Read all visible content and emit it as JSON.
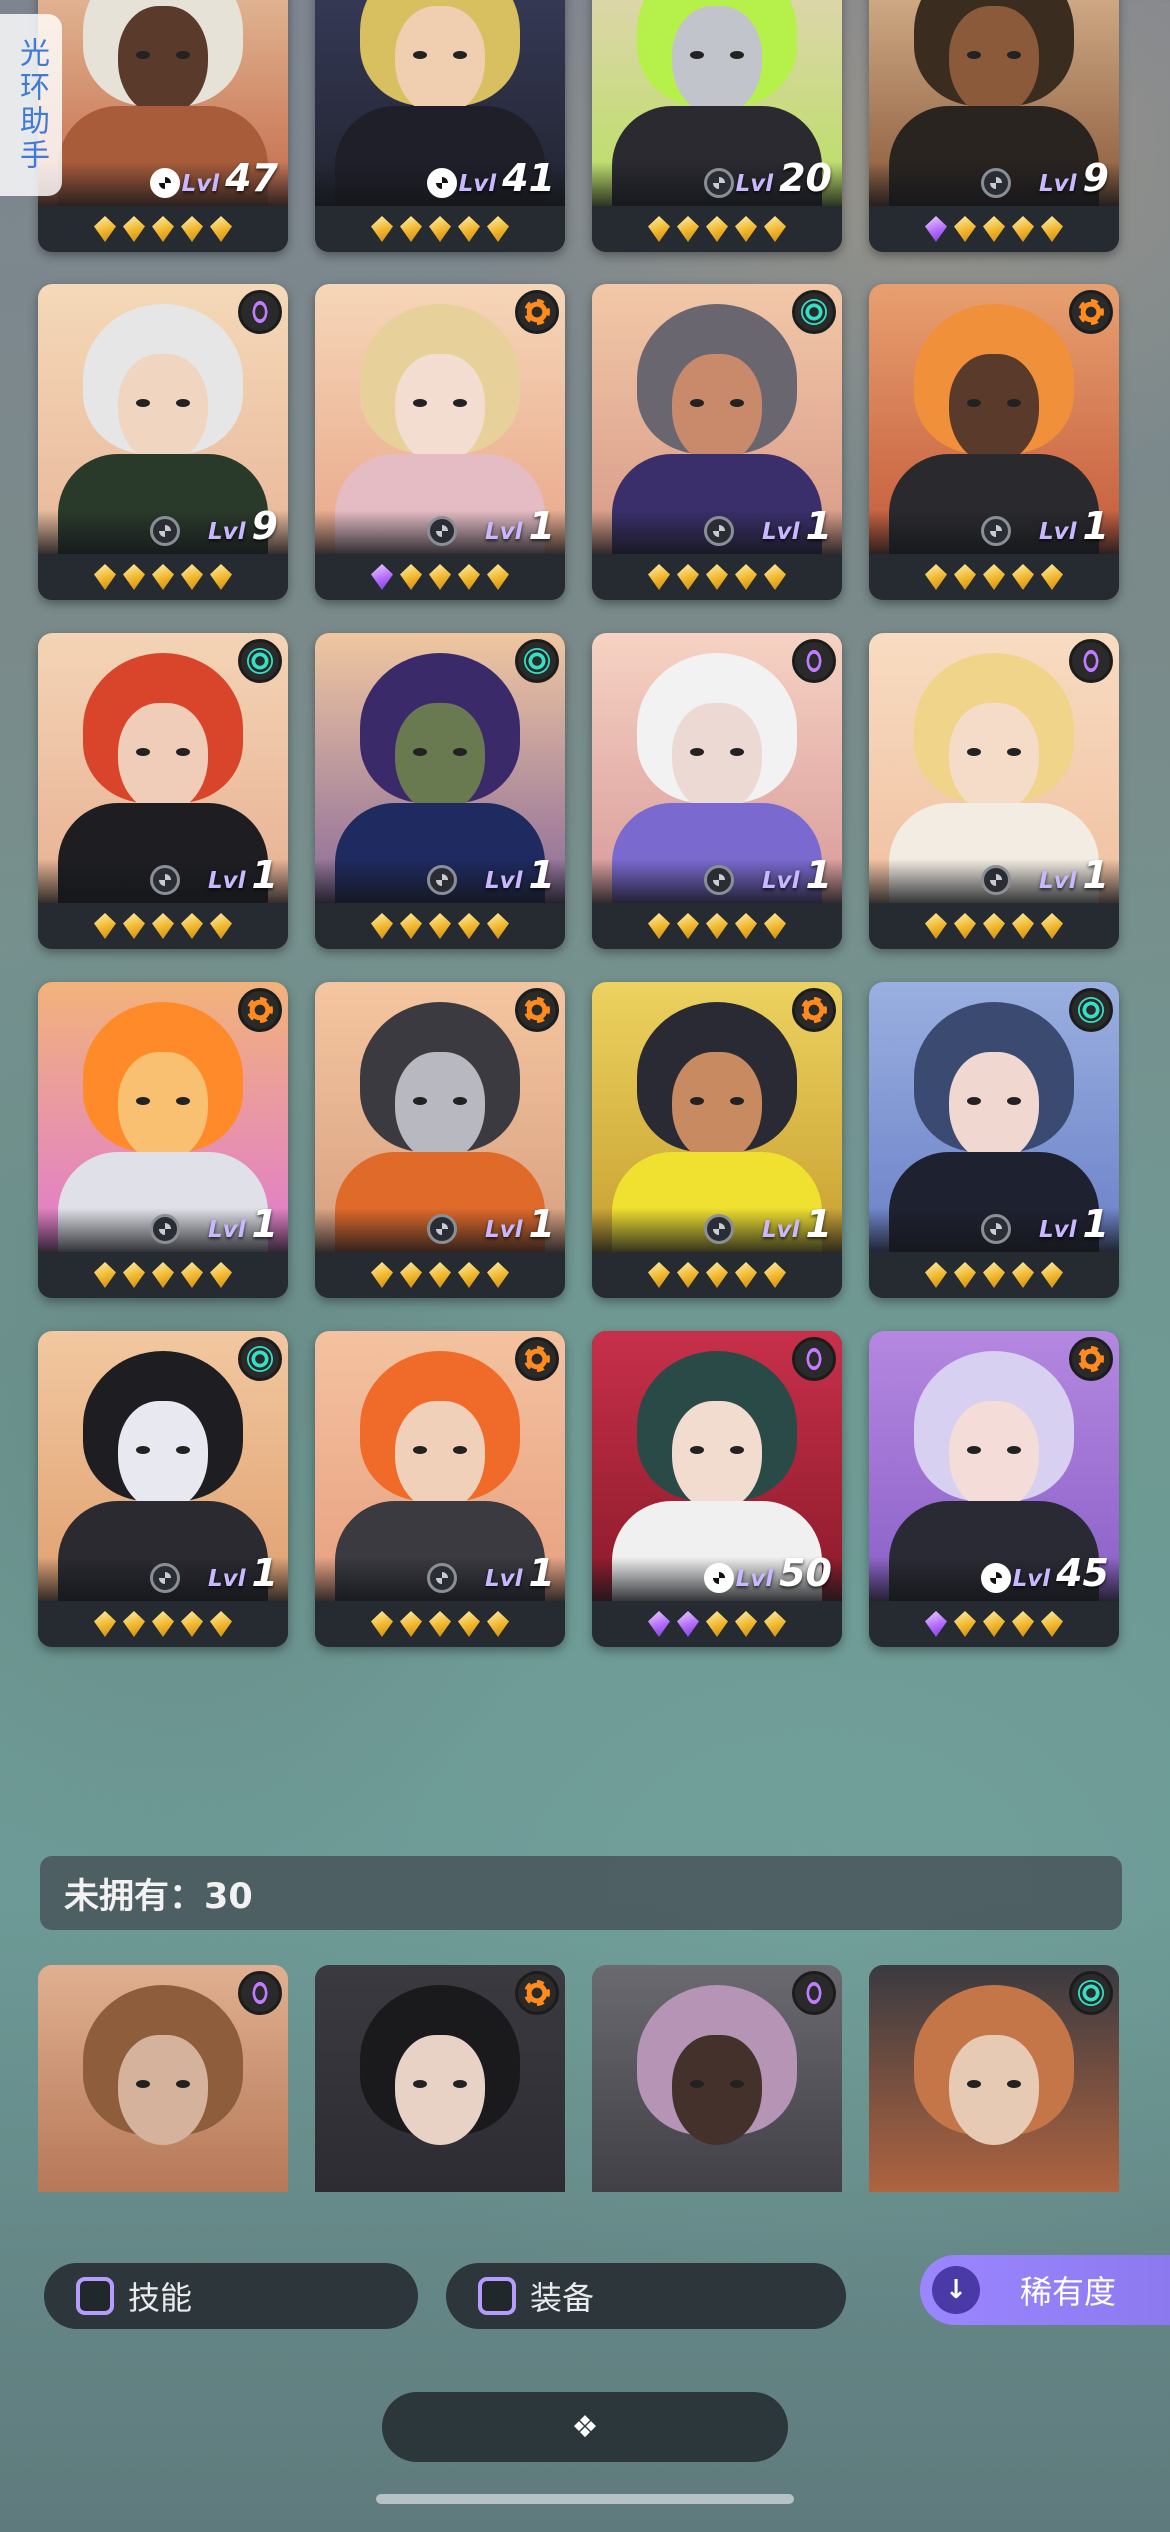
{
  "assistant": {
    "label": "光环助手"
  },
  "owned_cards": [
    {
      "level": "47",
      "stars": [
        "gold",
        "gold",
        "gold",
        "gold",
        "gold"
      ],
      "element": "",
      "bg": [
        "#e9c9a6",
        "#c46a4a"
      ],
      "hair": "#e6e2d8",
      "skin": "#5a3a2a",
      "outfit": "#a85c3a",
      "wheel": "white"
    },
    {
      "level": "41",
      "stars": [
        "gold",
        "gold",
        "gold",
        "gold",
        "gold"
      ],
      "element": "",
      "bg": [
        "#3a3f60",
        "#222430"
      ],
      "hair": "#d8c060",
      "skin": "#f0cfb0",
      "outfit": "#1f1f2a",
      "wheel": "white"
    },
    {
      "level": "20",
      "stars": [
        "gold",
        "gold",
        "gold",
        "gold",
        "gold"
      ],
      "element": "",
      "bg": [
        "#e8d2c0",
        "#b8e060"
      ],
      "hair": "#b6f04a",
      "skin": "#c2c4cc",
      "outfit": "#2a2a30",
      "wheel": "dark"
    },
    {
      "level": "9",
      "stars": [
        "purple",
        "gold",
        "gold",
        "gold",
        "gold"
      ],
      "element": "",
      "bg": [
        "#e2c09a",
        "#8a5a3a"
      ],
      "hair": "#3b2c20",
      "skin": "#8a5a3a",
      "outfit": "#2a2420",
      "wheel": "dark"
    },
    {
      "level": "9",
      "stars": [
        "gold",
        "gold",
        "gold",
        "gold",
        "gold"
      ],
      "element": "purple",
      "bg": [
        "#f4d9b8",
        "#e9b79a"
      ],
      "hair": "#e6e6e6",
      "skin": "#f0d5c0",
      "outfit": "#2a3a2a",
      "wheel": "dark"
    },
    {
      "level": "1",
      "stars": [
        "purple",
        "gold",
        "gold",
        "gold",
        "gold"
      ],
      "element": "orange",
      "bg": [
        "#f6d6b8",
        "#e9a78a"
      ],
      "hair": "#e8d09a",
      "skin": "#f3dcd0",
      "outfit": "#e5bcc4",
      "wheel": "dark"
    },
    {
      "level": "1",
      "stars": [
        "gold",
        "gold",
        "gold",
        "gold",
        "gold"
      ],
      "element": "green",
      "bg": [
        "#f2c8a8",
        "#d89a88"
      ],
      "hair": "#6a6670",
      "skin": "#c88a6a",
      "outfit": "#3a2f6a",
      "wheel": "dark"
    },
    {
      "level": "1",
      "stars": [
        "gold",
        "gold",
        "gold",
        "gold",
        "gold"
      ],
      "element": "orange",
      "bg": [
        "#e8a070",
        "#c45a3a"
      ],
      "hair": "#f0903a",
      "skin": "#5a3a2a",
      "outfit": "#2a2a2e",
      "wheel": "dark"
    },
    {
      "level": "1",
      "stars": [
        "gold",
        "gold",
        "gold",
        "gold",
        "gold"
      ],
      "element": "green",
      "bg": [
        "#f4d4b6",
        "#e8b092"
      ],
      "hair": "#d8452a",
      "skin": "#f0cdb8",
      "outfit": "#1e1e22",
      "wheel": "dark"
    },
    {
      "level": "1",
      "stars": [
        "gold",
        "gold",
        "gold",
        "gold",
        "gold"
      ],
      "element": "green",
      "bg": [
        "#f0c7a0",
        "#8a6a9a"
      ],
      "hair": "#3a2a6a",
      "skin": "#6a7a50",
      "outfit": "#1e2a60",
      "wheel": "dark"
    },
    {
      "level": "1",
      "stars": [
        "gold",
        "gold",
        "gold",
        "gold",
        "gold"
      ],
      "element": "purple",
      "bg": [
        "#f6d3c3",
        "#d89a9a"
      ],
      "hair": "#f2f2f2",
      "skin": "#ecd9d4",
      "outfit": "#7a6ad0",
      "wheel": "dark"
    },
    {
      "level": "1",
      "stars": [
        "gold",
        "gold",
        "gold",
        "gold",
        "gold"
      ],
      "element": "purple",
      "bg": [
        "#f8dcc2",
        "#f0c0a0"
      ],
      "hair": "#f0d48a",
      "skin": "#f4dcc8",
      "outfit": "#f3ece2",
      "wheel": "dark"
    },
    {
      "level": "1",
      "stars": [
        "gold",
        "gold",
        "gold",
        "gold",
        "gold"
      ],
      "element": "orange",
      "bg": [
        "#f2b37a",
        "#e07ad0"
      ],
      "hair": "#ff8a2a",
      "skin": "#f8c070",
      "outfit": "#e0e0e8",
      "wheel": "dark"
    },
    {
      "level": "1",
      "stars": [
        "gold",
        "gold",
        "gold",
        "gold",
        "gold"
      ],
      "element": "orange",
      "bg": [
        "#f4c6a0",
        "#d8a080"
      ],
      "hair": "#3a3a40",
      "skin": "#b8b8c0",
      "outfit": "#e06a2a",
      "wheel": "dark"
    },
    {
      "level": "1",
      "stars": [
        "gold",
        "gold",
        "gold",
        "gold",
        "gold"
      ],
      "element": "orange",
      "bg": [
        "#ecd260",
        "#c8a030"
      ],
      "hair": "#2a2a34",
      "skin": "#c88a60",
      "outfit": "#f0e030",
      "wheel": "dark"
    },
    {
      "level": "1",
      "stars": [
        "gold",
        "gold",
        "gold",
        "gold",
        "gold"
      ],
      "element": "green",
      "bg": [
        "#9ab0e0",
        "#6a80c8"
      ],
      "hair": "#3a4a70",
      "skin": "#f0d8d0",
      "outfit": "#1e2230",
      "wheel": "dark"
    },
    {
      "level": "1",
      "stars": [
        "gold",
        "gold",
        "gold",
        "gold",
        "gold"
      ],
      "element": "green",
      "bg": [
        "#f2c8a0",
        "#e0a070"
      ],
      "hair": "#1e1e22",
      "skin": "#e8e8f0",
      "outfit": "#2a2a30",
      "wheel": "dark"
    },
    {
      "level": "1",
      "stars": [
        "gold",
        "gold",
        "gold",
        "gold",
        "gold"
      ],
      "element": "orange",
      "bg": [
        "#f4c2a0",
        "#e8a080"
      ],
      "hair": "#f06a2a",
      "skin": "#f0d0b8",
      "outfit": "#3a3a40",
      "wheel": "dark"
    },
    {
      "level": "50",
      "stars": [
        "purple",
        "purple",
        "gold",
        "gold",
        "gold"
      ],
      "element": "purple",
      "bg": [
        "#c8304a",
        "#8a1a2a"
      ],
      "hair": "#2a4a48",
      "skin": "#f2dcd0",
      "outfit": "#f0f0f0",
      "wheel": "white"
    },
    {
      "level": "45",
      "stars": [
        "purple",
        "gold",
        "gold",
        "gold",
        "gold"
      ],
      "element": "orange",
      "bg": [
        "#b488e0",
        "#8a60c8"
      ],
      "hair": "#d8d0f0",
      "skin": "#f4dcd8",
      "outfit": "#2a2a34",
      "wheel": "white"
    }
  ],
  "unowned": {
    "label": "未拥有：30",
    "cards": [
      {
        "element": "purple",
        "bg": [
          "#e0b090",
          "#b07050"
        ],
        "hair": "#a05a2a",
        "skin": "#e0b090"
      },
      {
        "element": "orange",
        "bg": [
          "#3a3a40",
          "#2a2a30"
        ],
        "hair": "#1a1a1e",
        "skin": "#f0d0c0"
      },
      {
        "element": "purple",
        "bg": [
          "#6a6a70",
          "#3a3a40"
        ],
        "hair": "#c090c0",
        "skin": "#4a3028"
      },
      {
        "element": "green",
        "bg": [
          "#3a3a40",
          "#c06a40"
        ],
        "hair": "#e07030",
        "skin": "#f0c8a8"
      }
    ]
  },
  "filters": {
    "skill_label": "技能",
    "equip_label": "装备",
    "rarity_label": "稀有度"
  },
  "colors": {
    "accent": "#9b86ff",
    "gold": "#f0b62b",
    "purple_star": "#b36bff"
  }
}
